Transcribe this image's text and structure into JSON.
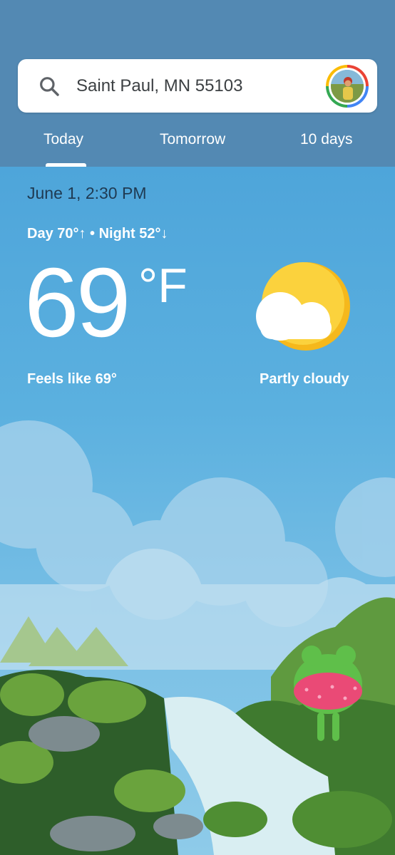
{
  "search": {
    "location": "Saint Paul, MN 55103"
  },
  "tabs": [
    {
      "label": "Today"
    },
    {
      "label": "Tomorrow"
    },
    {
      "label": "10 days"
    }
  ],
  "weather": {
    "datetime": "June 1, 2:30 PM",
    "day_night": "Day 70°↑ • Night 52°↓",
    "temperature": "69",
    "unit": "°F",
    "feels_like": "Feels like 69°",
    "condition": "Partly cloudy"
  },
  "icons": {
    "search": "search-icon",
    "avatar": "avatar",
    "weather": "partly-cloudy-icon"
  },
  "colors": {
    "header_bg": "#5389b3",
    "sky": "#4ea5da",
    "sun": "#fbd23d"
  }
}
